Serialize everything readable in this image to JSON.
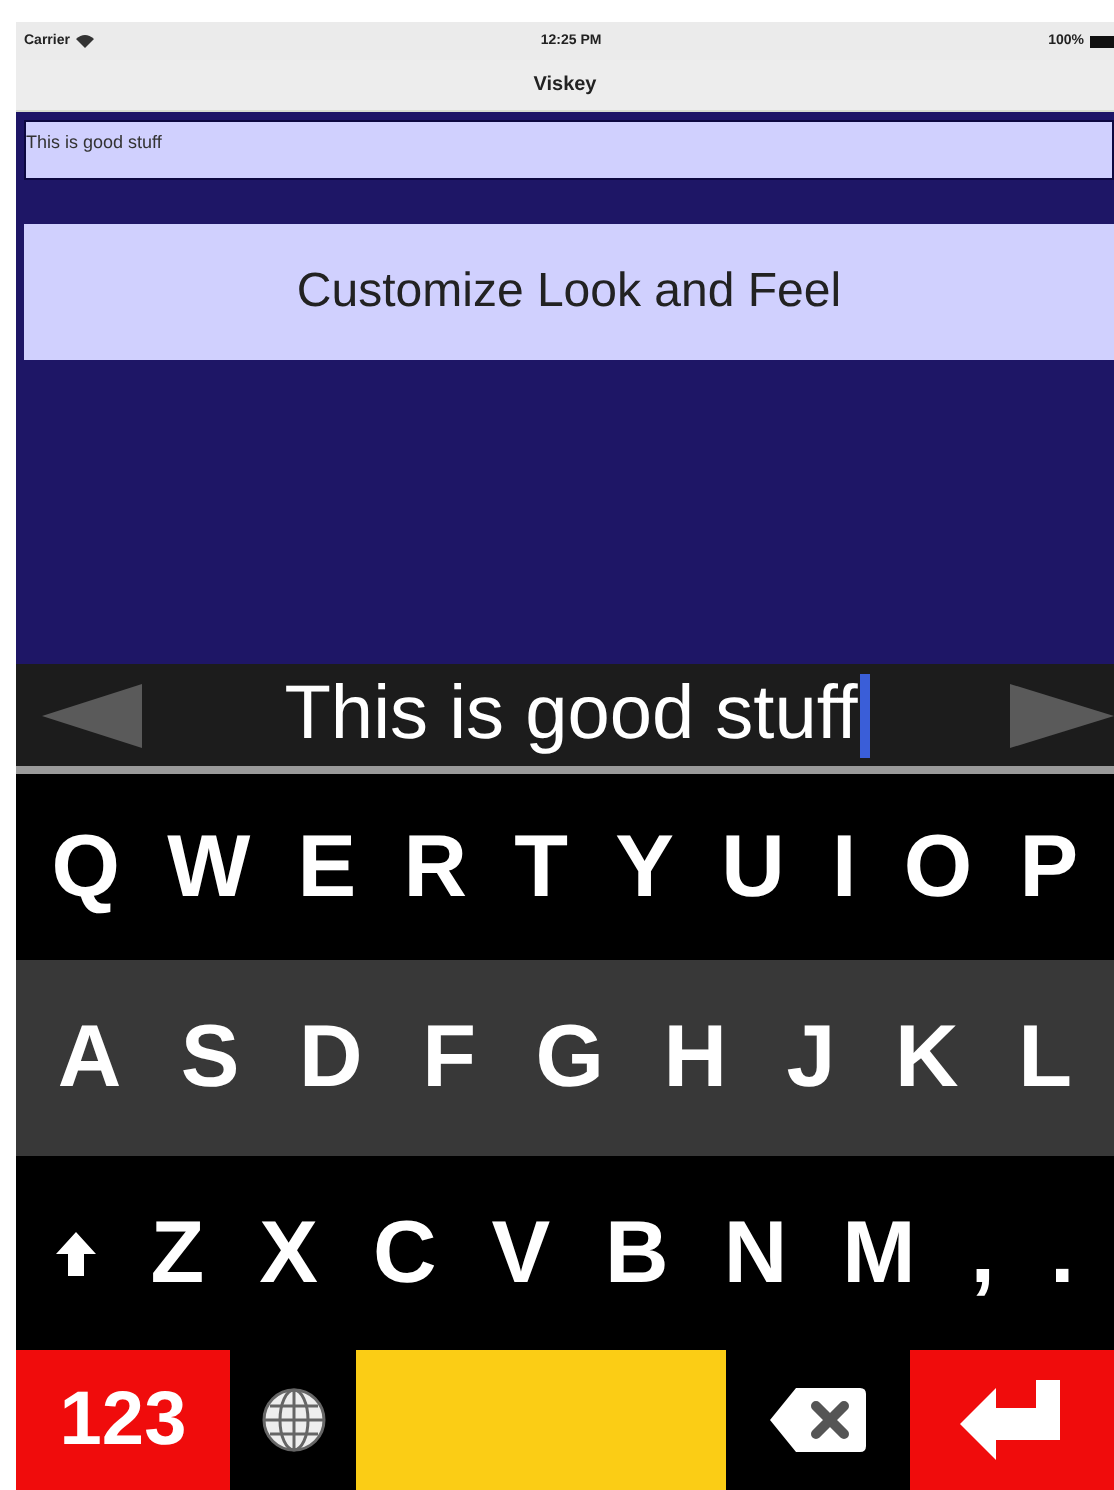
{
  "status_bar": {
    "carrier": "Carrier",
    "time": "12:25 PM",
    "battery": "100%"
  },
  "nav_bar": {
    "title": "Viskey"
  },
  "text_field": {
    "value": "This is good stuff"
  },
  "customize_button": {
    "label": "Customize Look and Feel"
  },
  "suggestion_bar": {
    "text": "This is good stuff"
  },
  "keyboard": {
    "rows": [
      {
        "keys": [
          {
            "kind": "letter",
            "label": "Q"
          },
          {
            "kind": "letter",
            "label": "W"
          },
          {
            "kind": "letter",
            "label": "E"
          },
          {
            "kind": "letter",
            "label": "R"
          },
          {
            "kind": "letter",
            "label": "T"
          },
          {
            "kind": "letter",
            "label": "Y"
          },
          {
            "kind": "letter",
            "label": "U"
          },
          {
            "kind": "letter",
            "label": "I"
          },
          {
            "kind": "letter",
            "label": "O"
          },
          {
            "kind": "letter",
            "label": "P"
          }
        ]
      },
      {
        "keys": [
          {
            "kind": "letter",
            "label": "A"
          },
          {
            "kind": "letter",
            "label": "S"
          },
          {
            "kind": "letter",
            "label": "D"
          },
          {
            "kind": "letter",
            "label": "F"
          },
          {
            "kind": "letter",
            "label": "G"
          },
          {
            "kind": "letter",
            "label": "H"
          },
          {
            "kind": "letter",
            "label": "J"
          },
          {
            "kind": "letter",
            "label": "K"
          },
          {
            "kind": "letter",
            "label": "L"
          }
        ]
      },
      {
        "keys": [
          {
            "kind": "shift"
          },
          {
            "kind": "letter",
            "label": "Z"
          },
          {
            "kind": "letter",
            "label": "X"
          },
          {
            "kind": "letter",
            "label": "C"
          },
          {
            "kind": "letter",
            "label": "V"
          },
          {
            "kind": "letter",
            "label": "B"
          },
          {
            "kind": "letter",
            "label": "N"
          },
          {
            "kind": "letter",
            "label": "M"
          },
          {
            "kind": "letter",
            "label": ","
          },
          {
            "kind": "letter",
            "label": "."
          }
        ]
      },
      {
        "keys": [
          {
            "kind": "numbers",
            "label": "123"
          },
          {
            "kind": "globe"
          },
          {
            "kind": "space"
          },
          {
            "kind": "backspace"
          },
          {
            "kind": "return"
          }
        ]
      }
    ]
  }
}
